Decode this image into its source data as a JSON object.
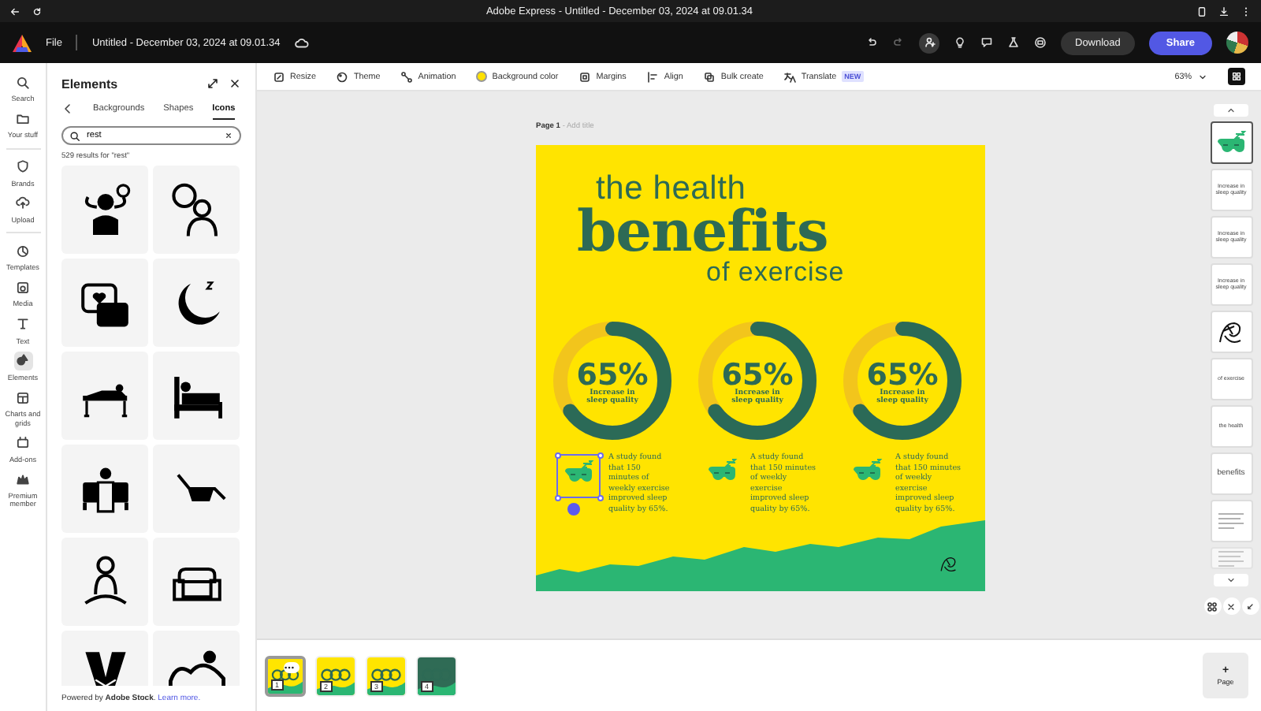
{
  "browser": {
    "title": "Adobe Express - Untitled - December 03, 2024 at 09.01.34"
  },
  "header": {
    "menu": "File",
    "document_title": "Untitled - December 03, 2024 at 09.01.34",
    "download": "Download",
    "share": "Share"
  },
  "rail": [
    {
      "label": "Search",
      "selected": false
    },
    {
      "label": "Your stuff",
      "selected": false
    },
    {
      "label": "Brands",
      "selected": false
    },
    {
      "label": "Upload",
      "selected": false
    },
    {
      "label": "Templates",
      "selected": false
    },
    {
      "label": "Media",
      "selected": false
    },
    {
      "label": "Text",
      "selected": false
    },
    {
      "label": "Elements",
      "selected": true
    },
    {
      "label": "Charts and grids",
      "selected": false
    },
    {
      "label": "Add-ons",
      "selected": false
    },
    {
      "label": "Premium member",
      "selected": false
    }
  ],
  "panel": {
    "title": "Elements",
    "tabs": [
      {
        "label": "Backgrounds",
        "selected": false
      },
      {
        "label": "Shapes",
        "selected": false
      },
      {
        "label": "Icons",
        "selected": true
      }
    ],
    "search": {
      "value": "rest"
    },
    "results": "529 results for \"rest\"",
    "footer": "Powered by **Adobe Stock**.",
    "footer_link": "Learn more."
  },
  "toolbar": {
    "items": [
      {
        "label": "Resize"
      },
      {
        "label": "Theme"
      },
      {
        "label": "Animation"
      },
      {
        "label": "Background color"
      },
      {
        "label": "Margins"
      },
      {
        "label": "Align"
      },
      {
        "label": "Bulk create"
      },
      {
        "label": "Translate",
        "badge": "NEW"
      }
    ],
    "zoom": "63%"
  },
  "page_label": {
    "name": "Page 1",
    "hint": "- Add title"
  },
  "poster": {
    "title_top": "the health",
    "title_main": "benefits",
    "title_bottom": "of exercise",
    "stats": [
      {
        "value": "65%",
        "caption": "Increase in sleep quality",
        "level": 0.65,
        "note": "A study found that 150 minutes of weekly exercise improved sleep quality by 65%.",
        "selected": true
      },
      {
        "value": "65%",
        "caption": "Increase in sleep quality",
        "level": 0.65,
        "note": "A study found that 150 minutes of weekly exercise improved sleep quality by 65%.",
        "selected": false
      },
      {
        "value": "65%",
        "caption": "Increase in sleep quality",
        "level": 0.65,
        "note": "A study found that 150 minutes of weekly exercise improved sleep quality by 65%.",
        "selected": false
      }
    ]
  },
  "layers": [
    {
      "kind": "icon",
      "selected": true
    },
    {
      "kind": "text",
      "text": "Increase in sleep quality",
      "selected": false
    },
    {
      "kind": "text",
      "text": "Increase in sleep quality",
      "selected": false
    },
    {
      "kind": "text",
      "text": "Increase in sleep quality",
      "selected": false
    },
    {
      "kind": "drawing",
      "selected": false
    },
    {
      "kind": "text",
      "text": "of exercise",
      "selected": false
    },
    {
      "kind": "text",
      "text": "the health",
      "selected": false
    },
    {
      "kind": "text",
      "text": "benefits",
      "selected": false
    },
    {
      "kind": "paragraph",
      "selected": false
    },
    {
      "kind": "paragraph",
      "selected": false
    }
  ],
  "pages": [
    {
      "number": "1",
      "color": "#ffe500",
      "selected": true
    },
    {
      "number": "2",
      "color": "#ffe500",
      "selected": false
    },
    {
      "number": "3",
      "color": "#ffe500",
      "selected": false
    },
    {
      "number": "4",
      "color": "#2f6b55",
      "selected": false
    }
  ],
  "add_page": {
    "icon": "+",
    "label": "Page"
  }
}
